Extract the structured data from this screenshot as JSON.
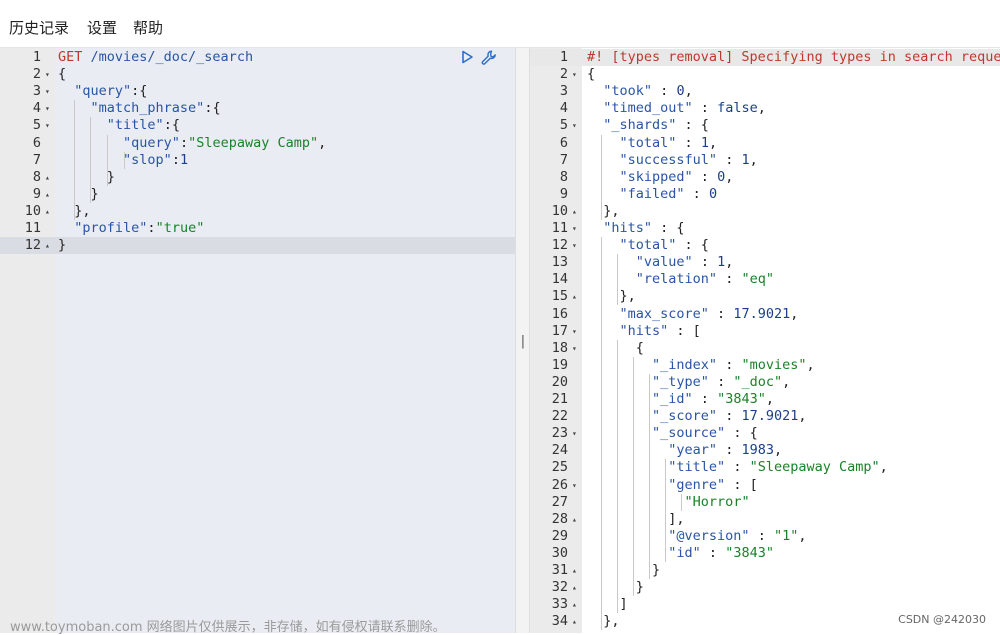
{
  "menu": {
    "items": [
      "历史记录",
      "设置",
      "帮助"
    ]
  },
  "left_editor": {
    "lines": [
      [
        {
          "t": "GET ",
          "c": "m"
        },
        {
          "t": "/movies/_doc/_search",
          "c": "k"
        }
      ],
      [
        {
          "t": "{",
          "c": "p"
        }
      ],
      [
        {
          "t": "  ",
          "c": "p"
        },
        {
          "t": "\"query\"",
          "c": "k"
        },
        {
          "t": ":{",
          "c": "p"
        }
      ],
      [
        {
          "t": "    ",
          "c": "p"
        },
        {
          "t": "\"match_phrase\"",
          "c": "k"
        },
        {
          "t": ":{",
          "c": "p"
        }
      ],
      [
        {
          "t": "      ",
          "c": "p"
        },
        {
          "t": "\"title\"",
          "c": "k"
        },
        {
          "t": ":{",
          "c": "p"
        }
      ],
      [
        {
          "t": "        ",
          "c": "p"
        },
        {
          "t": "\"query\"",
          "c": "k"
        },
        {
          "t": ":",
          "c": "p"
        },
        {
          "t": "\"Sleepaway Camp\"",
          "c": "s"
        },
        {
          "t": ",",
          "c": "p"
        }
      ],
      [
        {
          "t": "        ",
          "c": "p"
        },
        {
          "t": "\"slop\"",
          "c": "k"
        },
        {
          "t": ":",
          "c": "p"
        },
        {
          "t": "1",
          "c": "n"
        }
      ],
      [
        {
          "t": "      }",
          "c": "p"
        }
      ],
      [
        {
          "t": "    }",
          "c": "p"
        }
      ],
      [
        {
          "t": "  },",
          "c": "p"
        }
      ],
      [
        {
          "t": "  ",
          "c": "p"
        },
        {
          "t": "\"profile\"",
          "c": "k"
        },
        {
          "t": ":",
          "c": "p"
        },
        {
          "t": "\"true\"",
          "c": "s"
        }
      ],
      [
        {
          "t": "}",
          "c": "p"
        }
      ]
    ],
    "folds": [
      "",
      "down",
      "down",
      "down",
      "down",
      "",
      "",
      "up",
      "up",
      "up",
      "",
      "up"
    ],
    "active_line": 12
  },
  "right_editor": {
    "lines": [
      [
        {
          "t": "#! [types removal] Specifying types in search reque",
          "c": "c"
        }
      ],
      [
        {
          "t": "{",
          "c": "p"
        }
      ],
      [
        {
          "t": "  ",
          "c": "p"
        },
        {
          "t": "\"took\"",
          "c": "k"
        },
        {
          "t": " : ",
          "c": "p"
        },
        {
          "t": "0",
          "c": "n"
        },
        {
          "t": ",",
          "c": "p"
        }
      ],
      [
        {
          "t": "  ",
          "c": "p"
        },
        {
          "t": "\"timed_out\"",
          "c": "k"
        },
        {
          "t": " : ",
          "c": "p"
        },
        {
          "t": "false",
          "c": "n"
        },
        {
          "t": ",",
          "c": "p"
        }
      ],
      [
        {
          "t": "  ",
          "c": "p"
        },
        {
          "t": "\"_shards\"",
          "c": "k"
        },
        {
          "t": " : {",
          "c": "p"
        }
      ],
      [
        {
          "t": "    ",
          "c": "p"
        },
        {
          "t": "\"total\"",
          "c": "k"
        },
        {
          "t": " : ",
          "c": "p"
        },
        {
          "t": "1",
          "c": "n"
        },
        {
          "t": ",",
          "c": "p"
        }
      ],
      [
        {
          "t": "    ",
          "c": "p"
        },
        {
          "t": "\"successful\"",
          "c": "k"
        },
        {
          "t": " : ",
          "c": "p"
        },
        {
          "t": "1",
          "c": "n"
        },
        {
          "t": ",",
          "c": "p"
        }
      ],
      [
        {
          "t": "    ",
          "c": "p"
        },
        {
          "t": "\"skipped\"",
          "c": "k"
        },
        {
          "t": " : ",
          "c": "p"
        },
        {
          "t": "0",
          "c": "n"
        },
        {
          "t": ",",
          "c": "p"
        }
      ],
      [
        {
          "t": "    ",
          "c": "p"
        },
        {
          "t": "\"failed\"",
          "c": "k"
        },
        {
          "t": " : ",
          "c": "p"
        },
        {
          "t": "0",
          "c": "n"
        }
      ],
      [
        {
          "t": "  },",
          "c": "p"
        }
      ],
      [
        {
          "t": "  ",
          "c": "p"
        },
        {
          "t": "\"hits\"",
          "c": "k"
        },
        {
          "t": " : {",
          "c": "p"
        }
      ],
      [
        {
          "t": "    ",
          "c": "p"
        },
        {
          "t": "\"total\"",
          "c": "k"
        },
        {
          "t": " : {",
          "c": "p"
        }
      ],
      [
        {
          "t": "      ",
          "c": "p"
        },
        {
          "t": "\"value\"",
          "c": "k"
        },
        {
          "t": " : ",
          "c": "p"
        },
        {
          "t": "1",
          "c": "n"
        },
        {
          "t": ",",
          "c": "p"
        }
      ],
      [
        {
          "t": "      ",
          "c": "p"
        },
        {
          "t": "\"relation\"",
          "c": "k"
        },
        {
          "t": " : ",
          "c": "p"
        },
        {
          "t": "\"eq\"",
          "c": "s"
        }
      ],
      [
        {
          "t": "    },",
          "c": "p"
        }
      ],
      [
        {
          "t": "    ",
          "c": "p"
        },
        {
          "t": "\"max_score\"",
          "c": "k"
        },
        {
          "t": " : ",
          "c": "p"
        },
        {
          "t": "17.9021",
          "c": "n"
        },
        {
          "t": ",",
          "c": "p"
        }
      ],
      [
        {
          "t": "    ",
          "c": "p"
        },
        {
          "t": "\"hits\"",
          "c": "k"
        },
        {
          "t": " : [",
          "c": "p"
        }
      ],
      [
        {
          "t": "      {",
          "c": "p"
        }
      ],
      [
        {
          "t": "        ",
          "c": "p"
        },
        {
          "t": "\"_index\"",
          "c": "k"
        },
        {
          "t": " : ",
          "c": "p"
        },
        {
          "t": "\"movies\"",
          "c": "s"
        },
        {
          "t": ",",
          "c": "p"
        }
      ],
      [
        {
          "t": "        ",
          "c": "p"
        },
        {
          "t": "\"_type\"",
          "c": "k"
        },
        {
          "t": " : ",
          "c": "p"
        },
        {
          "t": "\"_doc\"",
          "c": "s"
        },
        {
          "t": ",",
          "c": "p"
        }
      ],
      [
        {
          "t": "        ",
          "c": "p"
        },
        {
          "t": "\"_id\"",
          "c": "k"
        },
        {
          "t": " : ",
          "c": "p"
        },
        {
          "t": "\"3843\"",
          "c": "s"
        },
        {
          "t": ",",
          "c": "p"
        }
      ],
      [
        {
          "t": "        ",
          "c": "p"
        },
        {
          "t": "\"_score\"",
          "c": "k"
        },
        {
          "t": " : ",
          "c": "p"
        },
        {
          "t": "17.9021",
          "c": "n"
        },
        {
          "t": ",",
          "c": "p"
        }
      ],
      [
        {
          "t": "        ",
          "c": "p"
        },
        {
          "t": "\"_source\"",
          "c": "k"
        },
        {
          "t": " : {",
          "c": "p"
        }
      ],
      [
        {
          "t": "          ",
          "c": "p"
        },
        {
          "t": "\"year\"",
          "c": "k"
        },
        {
          "t": " : ",
          "c": "p"
        },
        {
          "t": "1983",
          "c": "n"
        },
        {
          "t": ",",
          "c": "p"
        }
      ],
      [
        {
          "t": "          ",
          "c": "p"
        },
        {
          "t": "\"title\"",
          "c": "k"
        },
        {
          "t": " : ",
          "c": "p"
        },
        {
          "t": "\"Sleepaway Camp\"",
          "c": "s"
        },
        {
          "t": ",",
          "c": "p"
        }
      ],
      [
        {
          "t": "          ",
          "c": "p"
        },
        {
          "t": "\"genre\"",
          "c": "k"
        },
        {
          "t": " : [",
          "c": "p"
        }
      ],
      [
        {
          "t": "            ",
          "c": "p"
        },
        {
          "t": "\"Horror\"",
          "c": "s"
        }
      ],
      [
        {
          "t": "          ],",
          "c": "p"
        }
      ],
      [
        {
          "t": "          ",
          "c": "p"
        },
        {
          "t": "\"@version\"",
          "c": "k"
        },
        {
          "t": " : ",
          "c": "p"
        },
        {
          "t": "\"1\"",
          "c": "s"
        },
        {
          "t": ",",
          "c": "p"
        }
      ],
      [
        {
          "t": "          ",
          "c": "p"
        },
        {
          "t": "\"id\"",
          "c": "k"
        },
        {
          "t": " : ",
          "c": "p"
        },
        {
          "t": "\"3843\"",
          "c": "s"
        }
      ],
      [
        {
          "t": "        }",
          "c": "p"
        }
      ],
      [
        {
          "t": "      }",
          "c": "p"
        }
      ],
      [
        {
          "t": "    ]",
          "c": "p"
        }
      ],
      [
        {
          "t": "  },",
          "c": "p"
        }
      ]
    ],
    "folds": [
      "",
      "down",
      "",
      "",
      "down",
      "",
      "",
      "",
      "",
      "up",
      "down",
      "down",
      "",
      "",
      "up",
      "",
      "down",
      "down",
      "",
      "",
      "",
      "",
      "down",
      "",
      "",
      "down",
      "",
      "up",
      "",
      "",
      "up",
      "up",
      "up",
      "up"
    ],
    "active_line": 1
  },
  "divider": {
    "grip": "||"
  },
  "overlay": {
    "watermark": "www.toymoban.com 网络图片仅供展示，非存储，如有侵权请联系删除。",
    "credit": "CSDN @242030"
  },
  "colors": {
    "method": "#c0392b",
    "key": "#2a55a6",
    "string": "#1a8228",
    "number": "#1b3f8b",
    "comment": "#c0392b"
  }
}
